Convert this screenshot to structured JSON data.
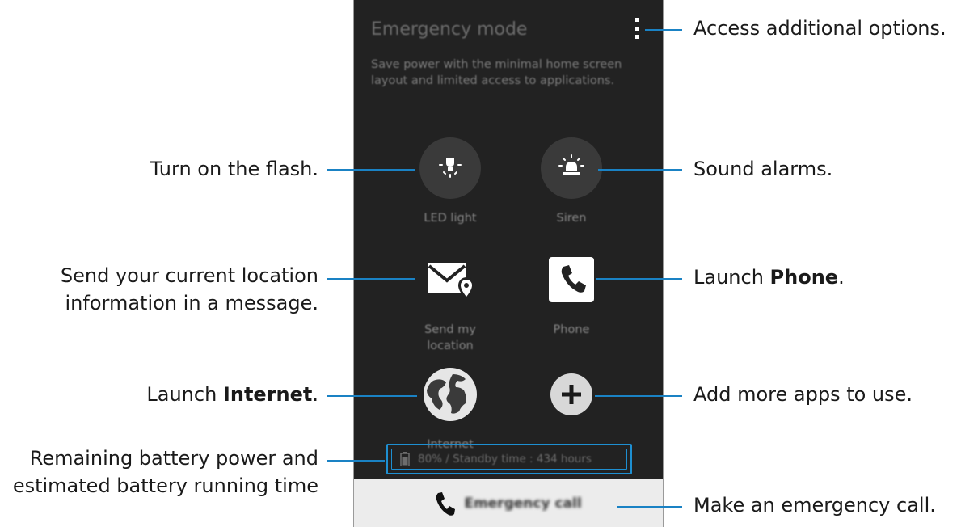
{
  "screen": {
    "title": "Emergency mode",
    "description": "Save power with the minimal home screen layout and limited access to applications.",
    "apps": [
      {
        "label": "LED light",
        "icon": "flashlight-icon"
      },
      {
        "label": "Siren",
        "icon": "siren-icon"
      },
      {
        "label": "Send my location",
        "icon": "send-location-icon"
      },
      {
        "label": "Phone",
        "icon": "phone-icon"
      },
      {
        "label": "Internet",
        "icon": "globe-icon"
      },
      {
        "label": "",
        "icon": "add-icon"
      }
    ],
    "battery_status": "80% / Standby time : 434 hours",
    "emergency_call_label": "Emergency call"
  },
  "callouts": {
    "options": "Access additional options.",
    "flash": "Turn on the flash.",
    "alarms": "Sound alarms.",
    "location_line1": "Send your current location",
    "location_line2": "information in a message.",
    "phone_prefix": "Launch ",
    "phone_bold": "Phone",
    "phone_suffix": ".",
    "internet_prefix": "Launch ",
    "internet_bold": "Internet",
    "internet_suffix": ".",
    "add_apps": "Add more apps to use.",
    "battery_line1": "Remaining battery power and",
    "battery_line2": "estimated battery running time",
    "emergency_call": "Make an emergency call."
  },
  "colors": {
    "screen_bg": "#222222",
    "callout_line": "#1a82c4",
    "battery_frame": "#1e8fd1",
    "call_bar_bg": "#ececec"
  }
}
